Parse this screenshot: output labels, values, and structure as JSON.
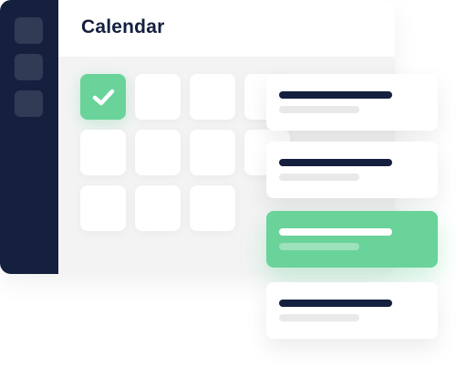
{
  "window": {
    "title": "Calendar"
  },
  "sidebar": {
    "items": [
      {
        "icon": "square-icon"
      },
      {
        "icon": "square-icon"
      },
      {
        "icon": "square-icon"
      }
    ]
  },
  "calendar": {
    "checked_cell": {
      "row": 1,
      "col": 1
    }
  },
  "events": [
    {
      "highlighted": false
    },
    {
      "highlighted": false
    },
    {
      "highlighted": true
    },
    {
      "highlighted": false
    }
  ],
  "colors": {
    "navy": "#15203f",
    "green": "#69d39a",
    "panel_bg": "#f3f3f3",
    "muted_line": "#e9e9e9",
    "white": "#ffffff"
  }
}
